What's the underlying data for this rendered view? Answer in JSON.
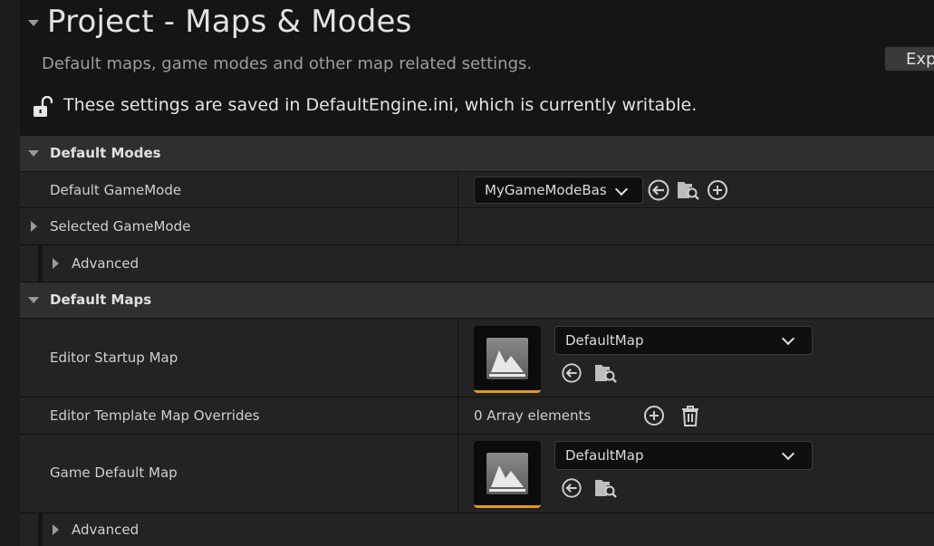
{
  "header": {
    "title": "Project - Maps & Modes",
    "subtitle": "Default maps, game modes and other map related settings.",
    "export_label": "Exp",
    "saved_notice": "These settings are saved in DefaultEngine.ini, which is currently writable."
  },
  "sections": {
    "default_modes": {
      "label": "Default Modes",
      "default_gamemode": {
        "label": "Default GameMode",
        "value": "MyGameModeBase"
      },
      "selected_gamemode": {
        "label": "Selected GameMode"
      },
      "advanced": {
        "label": "Advanced"
      }
    },
    "default_maps": {
      "label": "Default Maps",
      "editor_startup_map": {
        "label": "Editor Startup Map",
        "value": "DefaultMap"
      },
      "editor_template_overrides": {
        "label": "Editor Template Map Overrides",
        "value": "0 Array elements"
      },
      "game_default_map": {
        "label": "Game Default Map",
        "value": "DefaultMap"
      },
      "advanced": {
        "label": "Advanced"
      }
    }
  },
  "colors": {
    "accent_underline": "#e09a1a",
    "category_bg": "#2f2f2f",
    "row_bg": "#232323"
  },
  "icons": [
    "collapse-arrow-icon",
    "unlock-icon",
    "use-selected-arrow-icon",
    "browse-asset-icon",
    "add-icon",
    "delete-icon",
    "map-thumbnail-icon",
    "chevron-down-icon"
  ]
}
